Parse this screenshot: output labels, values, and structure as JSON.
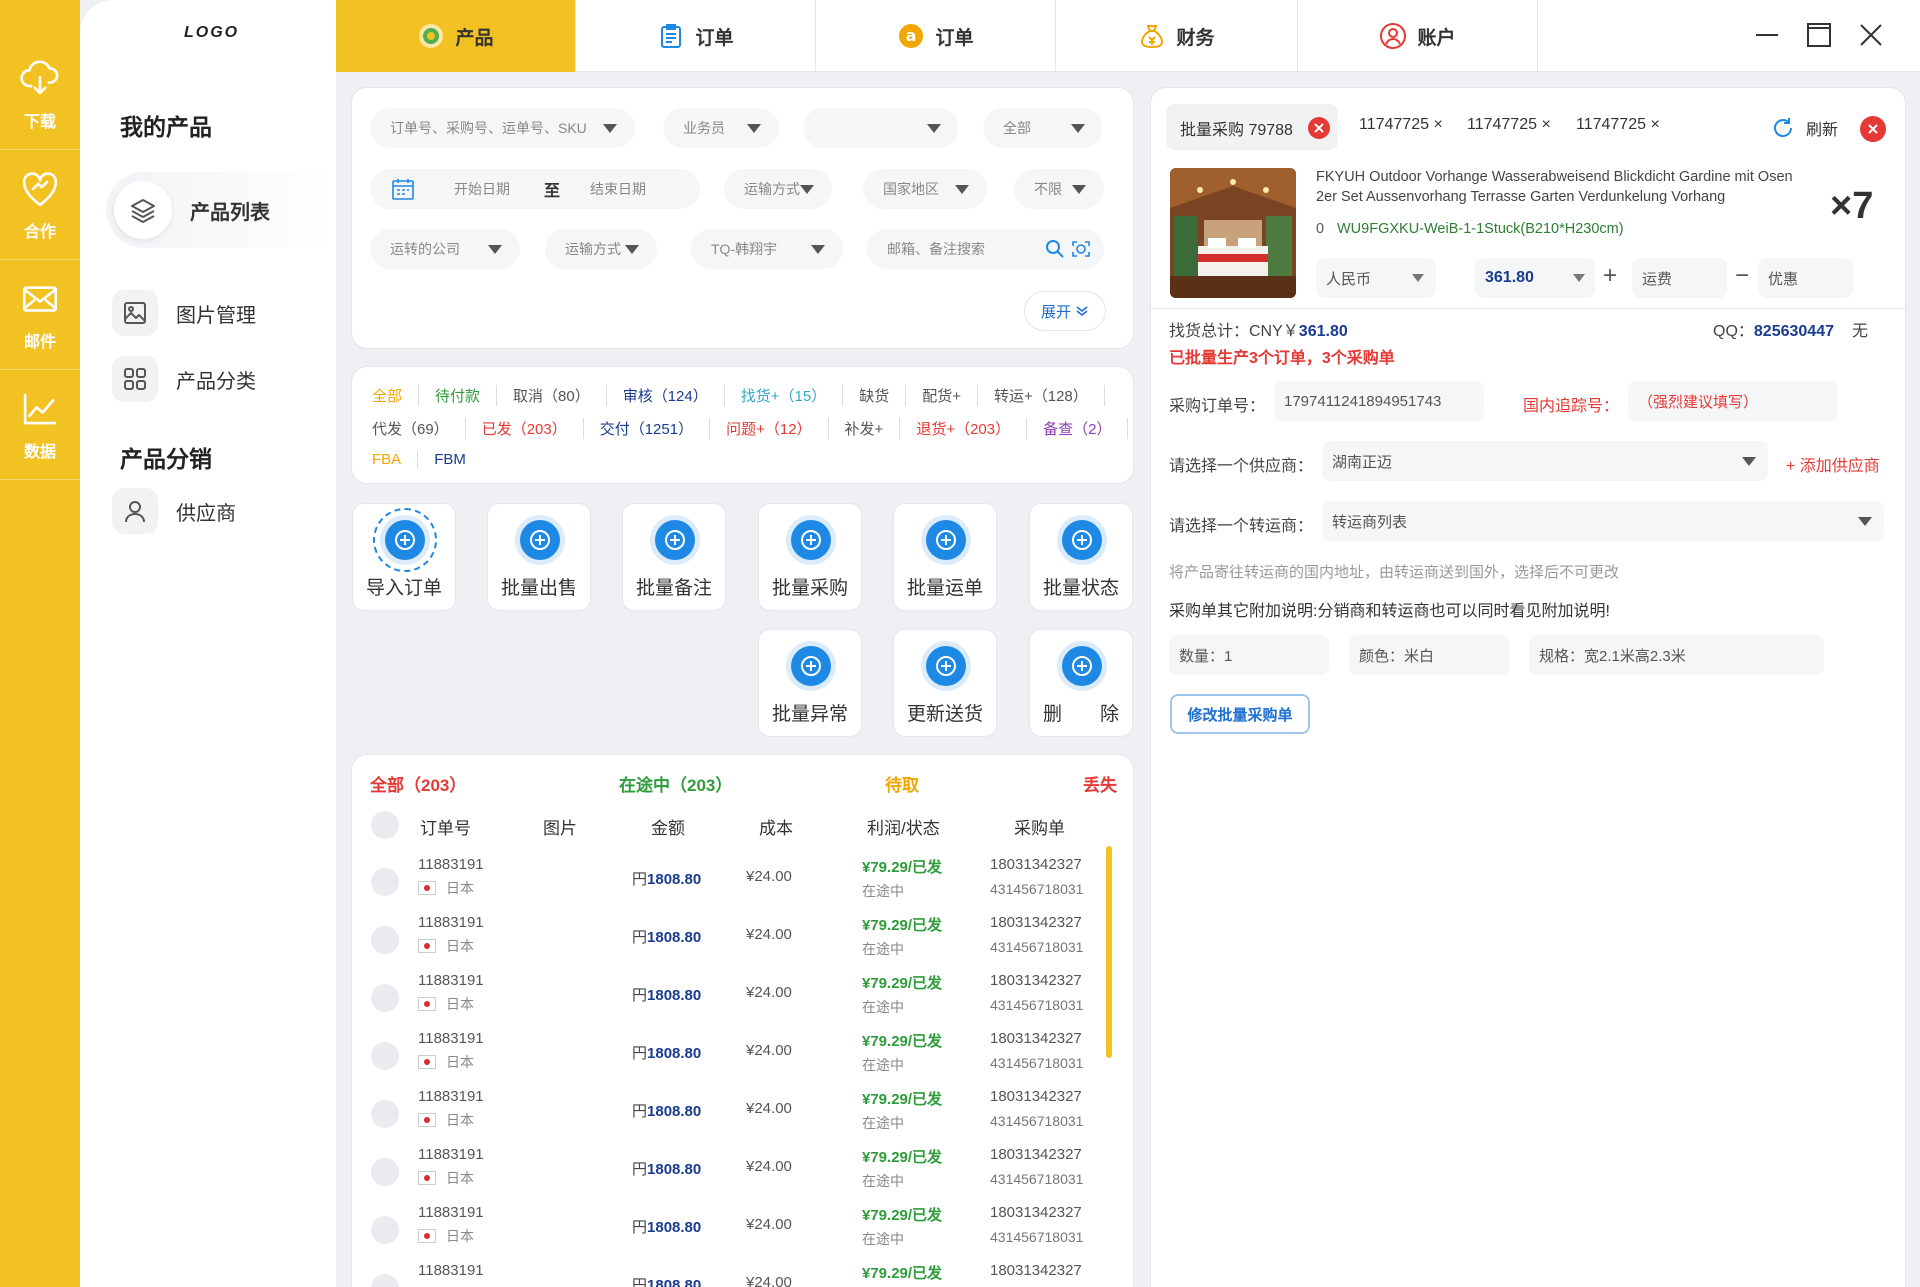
{
  "rail": {
    "items": [
      {
        "label": "下载",
        "icon": "cloud-download-icon"
      },
      {
        "label": "合作",
        "icon": "handshake-heart-icon"
      },
      {
        "label": "邮件",
        "icon": "mail-icon"
      },
      {
        "label": "数据",
        "icon": "line-chart-icon"
      }
    ]
  },
  "sidenav": {
    "logo": "LOGO",
    "section1": "我的产品",
    "section2": "产品分销",
    "items": [
      {
        "label": "产品列表",
        "icon": "layers-icon"
      },
      {
        "label": "图片管理",
        "icon": "image-icon"
      },
      {
        "label": "产品分类",
        "icon": "grid-icon"
      },
      {
        "label": "供应商",
        "icon": "user-icon"
      }
    ]
  },
  "topnav": {
    "tabs": [
      {
        "label": "产品",
        "icon": "product-icon"
      },
      {
        "label": "订单",
        "icon": "clipboard-icon"
      },
      {
        "label": "订单",
        "icon": "amazon-icon"
      },
      {
        "label": "财务",
        "icon": "money-bag-icon"
      },
      {
        "label": "账户",
        "icon": "account-icon"
      }
    ]
  },
  "filters": {
    "row1": [
      "订单号、采购号、运单号、SKU",
      "业务员",
      "",
      "全部"
    ],
    "start_date": "开始日期",
    "to": "至",
    "end_date": "结束日期",
    "row2": [
      "运输方式",
      "国家地区",
      "不限"
    ],
    "row3": [
      "运转的公司",
      "运输方式",
      "TQ-韩翔宇"
    ],
    "search_placeholder": "邮箱、备注搜索",
    "expand": "展开"
  },
  "status_tabs": {
    "line1": [
      "全部",
      "待付款",
      "取消（80）",
      "审核（124）",
      "找货+（15）",
      "缺货",
      "配货+",
      "转运+（128）"
    ],
    "line2": [
      "代发（69）",
      "已发（203）",
      "交付（1251）",
      "问题+（12）",
      "补发+",
      "退货+（203）",
      "备查（2）"
    ],
    "line3": [
      "FBA",
      "FBM"
    ],
    "colors": {
      "all": "#f2a600",
      "pending_pay": "#2e9c3c",
      "cancel": "#555555",
      "review": "#1a3b8f",
      "find": "#33a7c9",
      "out": "#555555",
      "alloc": "#555555",
      "transfer": "#555555",
      "dropship": "#555555",
      "shipped": "#e53935",
      "delivered": "#1a3b8f",
      "issue": "#e53935",
      "resend": "#555555",
      "return": "#e53935",
      "check": "#8e3fb5",
      "fba": "#f2a600",
      "fbm": "#1a3b8f"
    }
  },
  "tools": [
    "导入订单",
    "批量出售",
    "批量备注",
    "批量采购",
    "批量运单",
    "批量状态",
    "批量异常",
    "更新送货",
    "删　　除"
  ],
  "list": {
    "tab_all": "全部（203）",
    "tab_transit": "在途中（203）",
    "tab_pickup": "待取",
    "tab_lost": "丢失",
    "headers": [
      "订单号",
      "图片",
      "金额",
      "成本",
      "利润/状态",
      "采购单"
    ],
    "rows": [
      {
        "order": "11883191",
        "country": "日本",
        "amount_prefix": "円",
        "amount": "1808.80",
        "cost": "¥24.00",
        "profit": "¥79.29/已发",
        "status": "在途中",
        "po": "18031342327",
        "po2": "431456718031"
      },
      {
        "order": "11883191",
        "country": "日本",
        "amount_prefix": "円",
        "amount": "1808.80",
        "cost": "¥24.00",
        "profit": "¥79.29/已发",
        "status": "在途中",
        "po": "18031342327",
        "po2": "431456718031"
      },
      {
        "order": "11883191",
        "country": "日本",
        "amount_prefix": "円",
        "amount": "1808.80",
        "cost": "¥24.00",
        "profit": "¥79.29/已发",
        "status": "在途中",
        "po": "18031342327",
        "po2": "431456718031"
      },
      {
        "order": "11883191",
        "country": "日本",
        "amount_prefix": "円",
        "amount": "1808.80",
        "cost": "¥24.00",
        "profit": "¥79.29/已发",
        "status": "在途中",
        "po": "18031342327",
        "po2": "431456718031"
      },
      {
        "order": "11883191",
        "country": "日本",
        "amount_prefix": "円",
        "amount": "1808.80",
        "cost": "¥24.00",
        "profit": "¥79.29/已发",
        "status": "在途中",
        "po": "18031342327",
        "po2": "431456718031"
      },
      {
        "order": "11883191",
        "country": "日本",
        "amount_prefix": "円",
        "amount": "1808.80",
        "cost": "¥24.00",
        "profit": "¥79.29/已发",
        "status": "在途中",
        "po": "18031342327",
        "po2": "431456718031"
      },
      {
        "order": "11883191",
        "country": "日本",
        "amount_prefix": "円",
        "amount": "1808.80",
        "cost": "¥24.00",
        "profit": "¥79.29/已发",
        "status": "在途中",
        "po": "18031342327",
        "po2": "431456718031"
      },
      {
        "order": "11883191",
        "country": "",
        "amount_prefix": "円",
        "amount": "1808.80",
        "cost": "¥24.00",
        "profit": "¥79.29/已发",
        "status": "",
        "po": "18031342327",
        "po2": ""
      }
    ]
  },
  "right": {
    "tab_main": "批量采购 79788",
    "tabs": [
      "11747725 ×",
      "11747725 ×",
      "11747725 ×"
    ],
    "refresh": "刷新",
    "product_title": "FKYUH Outdoor Vorhange Wasserabweisend Blickdicht Gardine mit Osen 2er Set Aussenvorhang Terrasse Garten Verdunkelung Vorhang",
    "qty_badge": "×7",
    "sku_index": "0",
    "sku": "WU9FGXKU-WeiB-1-1Stuck(B210*H230cm)",
    "currency": "人民币",
    "price": "361.80",
    "plus": "+",
    "shipping": "运费",
    "minus": "−",
    "discount": "优惠",
    "total_label": "找货总计：CNY￥",
    "total_value": "361.80",
    "qq_label": "QQ：",
    "qq_value": "825630447",
    "qq_none": "无",
    "warning": "已批量生产3个订单，3个采购单",
    "po_label": "采购订单号：",
    "po_value": "1797411241894951743",
    "track_label": "国内追踪号：",
    "track_placeholder": "（强烈建议填写）",
    "supplier_label": "请选择一个供应商：",
    "supplier_value": "湖南正迈",
    "add_supplier": "+ 添加供应商",
    "forwarder_label": "请选择一个转运商：",
    "forwarder_value": "转运商列表",
    "note1": "将产品寄往转运商的国内地址，由转运商送到国外，选择后不可更改",
    "note2": "采购单其它附加说明:分销商和转运商也可以同时看见附加说明!",
    "qty_field": "数量：1",
    "color_field": "颜色：米白",
    "spec_field": "规格：宽2.1米高2.3米",
    "modify_btn": "修改批量采购单"
  }
}
